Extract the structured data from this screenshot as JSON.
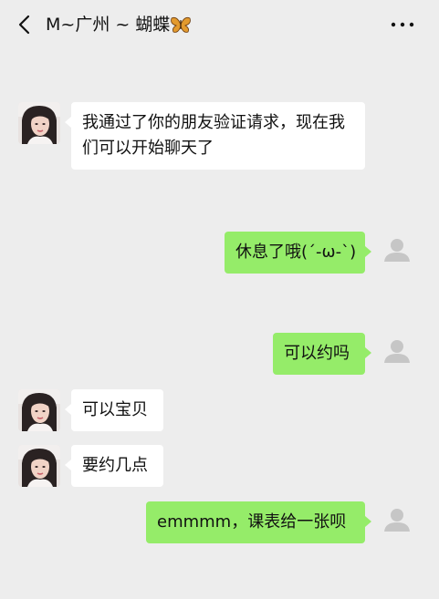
{
  "header": {
    "title": "M~广州 ~ 蝴蝶",
    "back_icon": "chevron-left-icon",
    "more_icon": "more-horizontal-icon",
    "title_emoji": "butterfly-icon"
  },
  "colors": {
    "background": "#ededed",
    "incoming_bubble": "#ffffff",
    "outgoing_bubble": "#95ec69",
    "default_avatar": "#c6c6c6"
  },
  "messages": [
    {
      "sender": "contact",
      "text": "我通过了你的朋友验证请求，现在我们可以开始聊天了"
    },
    {
      "sender": "me",
      "text": "休息了哦(´-ω-`)"
    },
    {
      "sender": "me",
      "text": "可以约吗"
    },
    {
      "sender": "contact",
      "text": "可以宝贝"
    },
    {
      "sender": "contact",
      "text": "要约几点"
    },
    {
      "sender": "me",
      "text": "emmmm，课表给一张呗"
    }
  ]
}
